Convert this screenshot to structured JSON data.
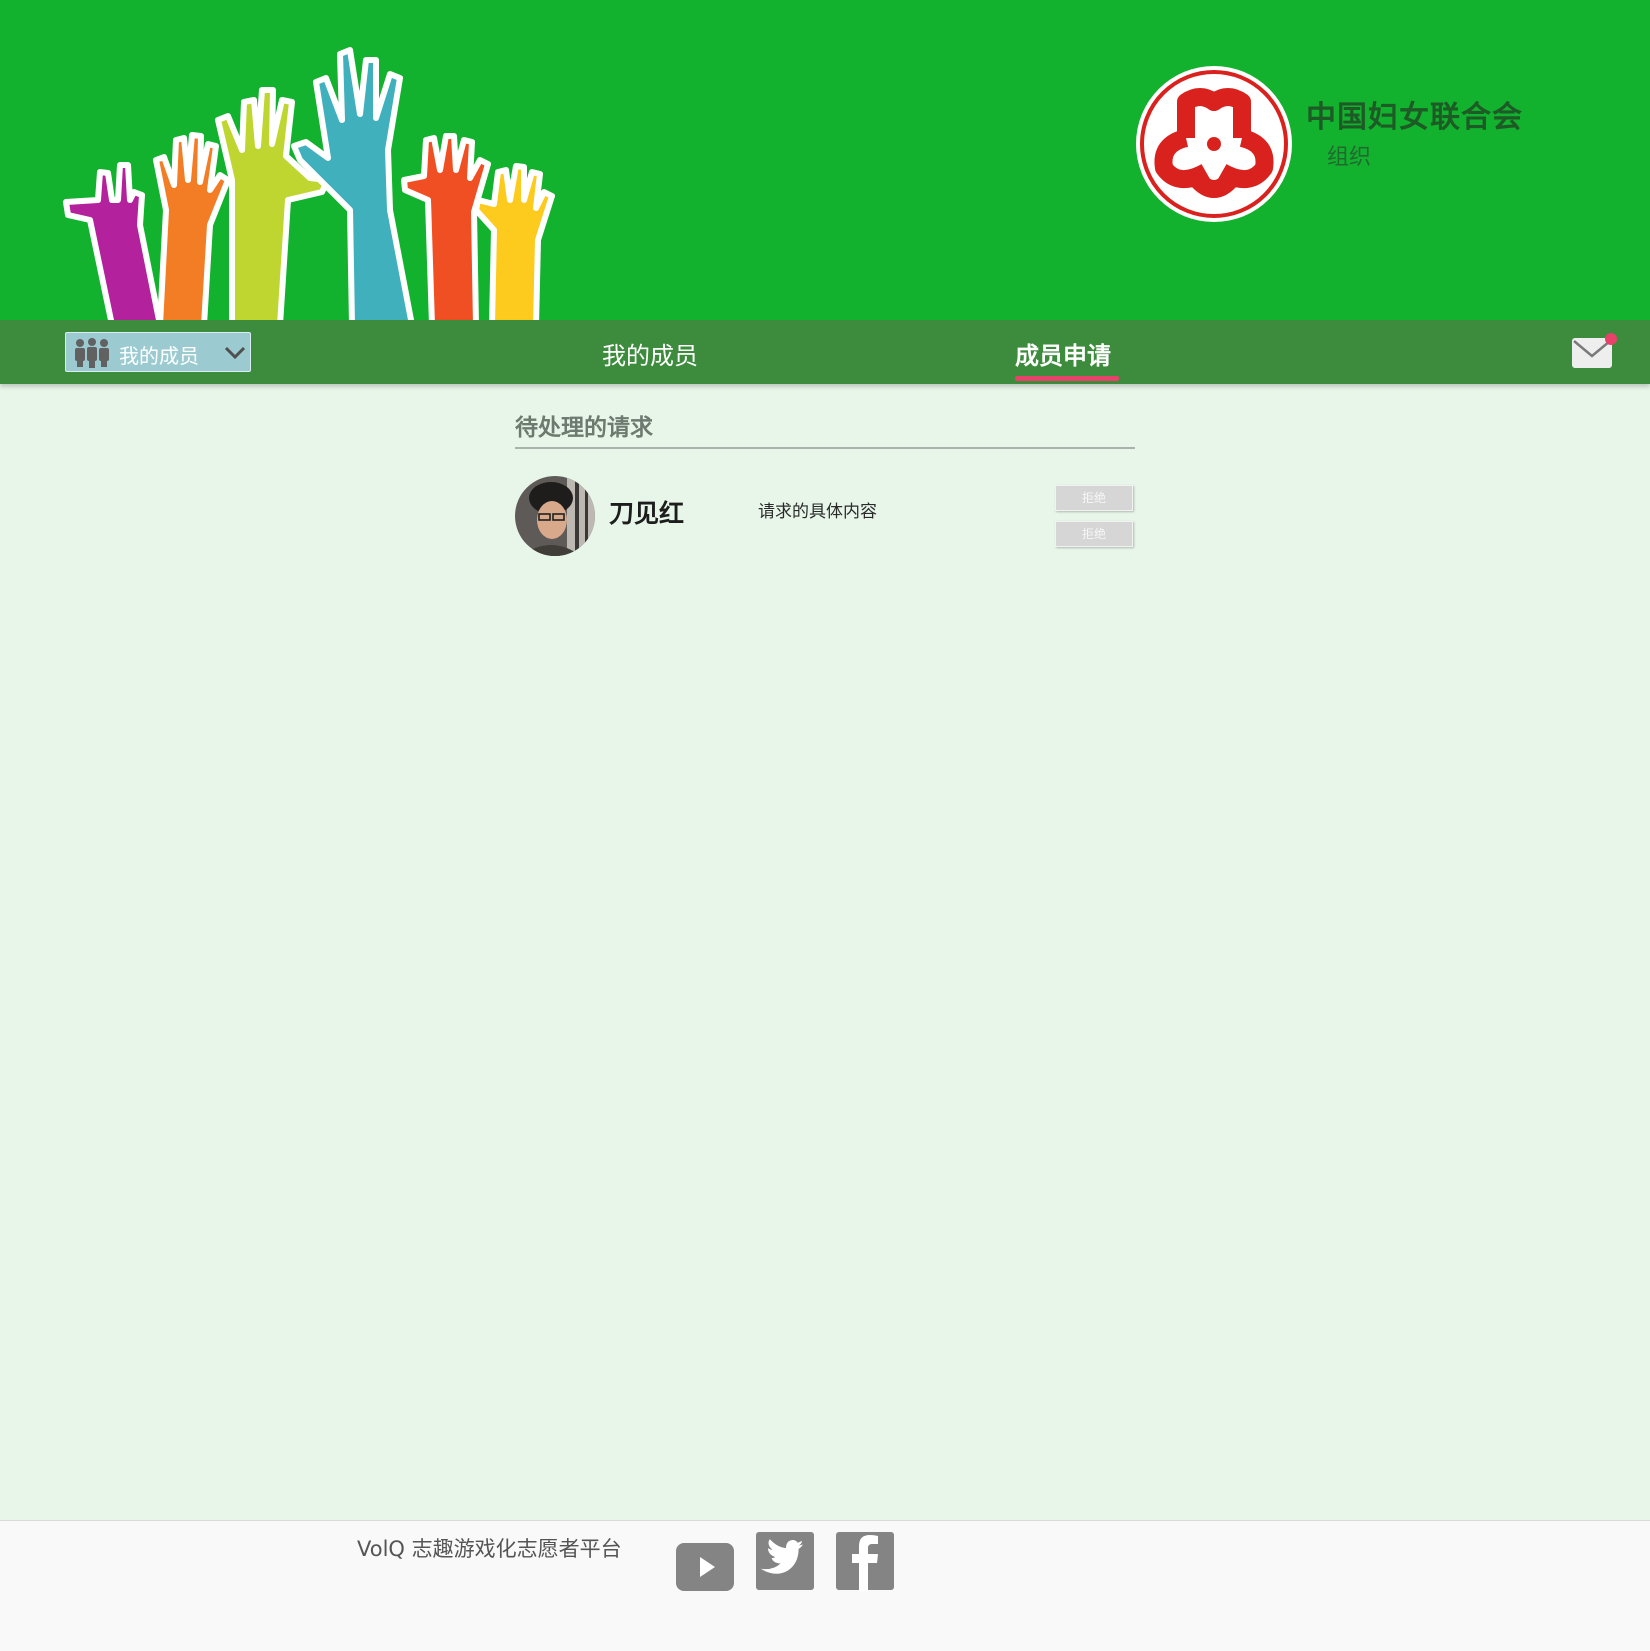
{
  "banner": {
    "org_name": "中国妇女联合会",
    "org_type": "组织",
    "logo_icon": "womens-federation-emblem-icon"
  },
  "nav": {
    "dropdown_label": "我的成员",
    "dropdown_icon": "people-group-icon",
    "tabs": [
      {
        "label": "我的成员",
        "active": false
      },
      {
        "label": "成员申请",
        "active": true
      }
    ],
    "mail_icon": "mail-icon",
    "has_unread": true
  },
  "main": {
    "section_title": "待处理的请求",
    "requests": [
      {
        "name": "刀见红",
        "content": "请求的具体内容",
        "buttons": [
          "拒绝",
          "拒绝"
        ]
      }
    ]
  },
  "footer": {
    "text": "VolQ 志趣游戏化志愿者平台",
    "social": [
      "youtube-icon",
      "twitter-icon",
      "facebook-icon"
    ]
  },
  "colors": {
    "banner": "#12b22e",
    "nav": "#3d8b3d",
    "accent": "#e8416a",
    "background": "#e8f6ea",
    "logo_red": "#d9221e"
  }
}
